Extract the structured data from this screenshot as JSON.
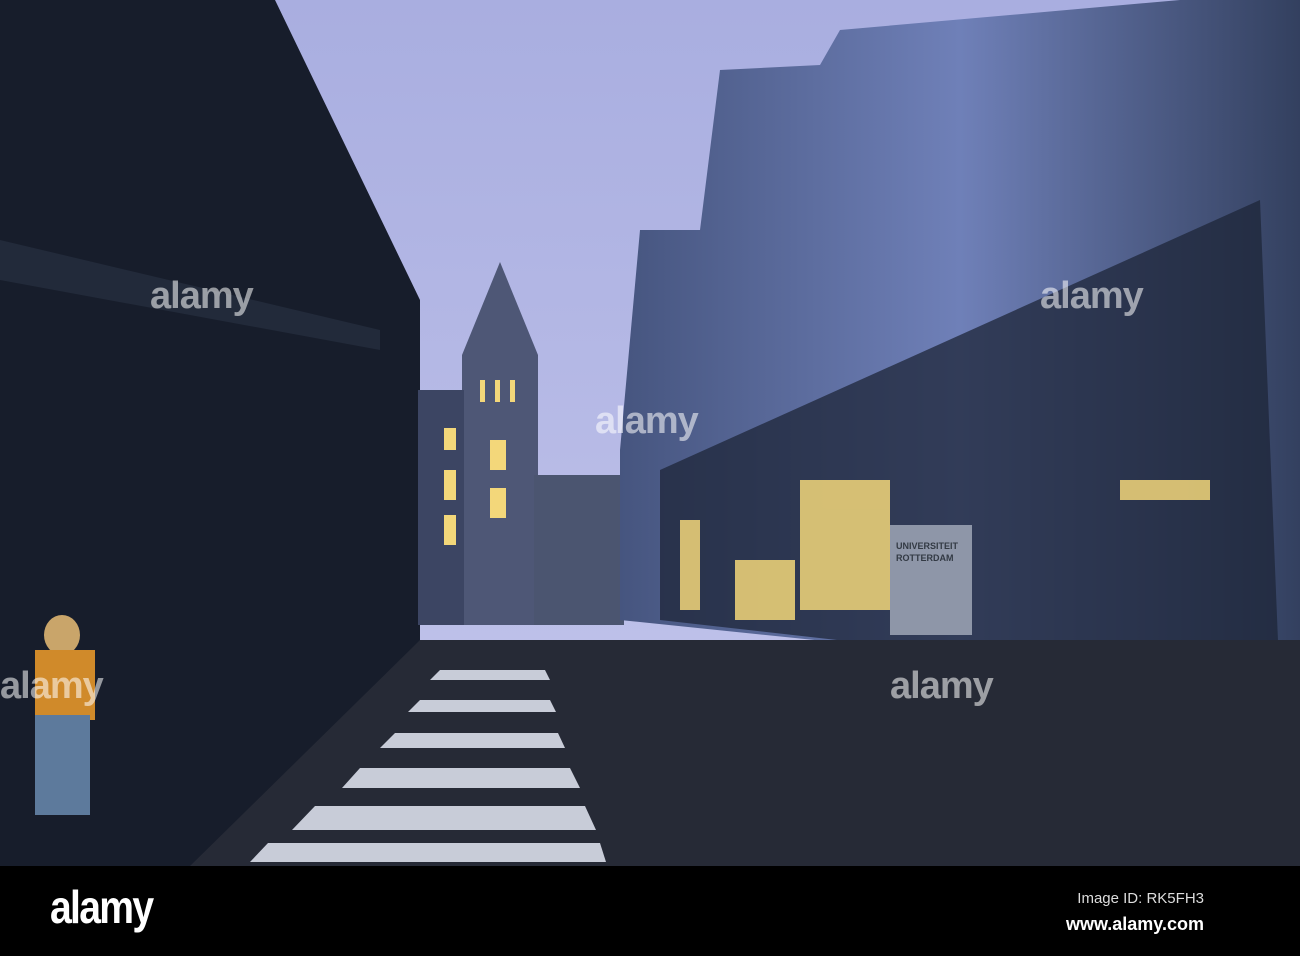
{
  "footer": {
    "logo": "alamy",
    "image_id": "Image ID: RK5FH3",
    "website": "www.alamy.com"
  },
  "watermark": "alamy",
  "sign_text": [
    "UNIVERSITEIT",
    "ROTTERDAM"
  ],
  "colors": {
    "sky": "#b4b8e4",
    "glass": "#5c6fa8",
    "dark": "#161c2a",
    "light": "#f3d77a"
  }
}
